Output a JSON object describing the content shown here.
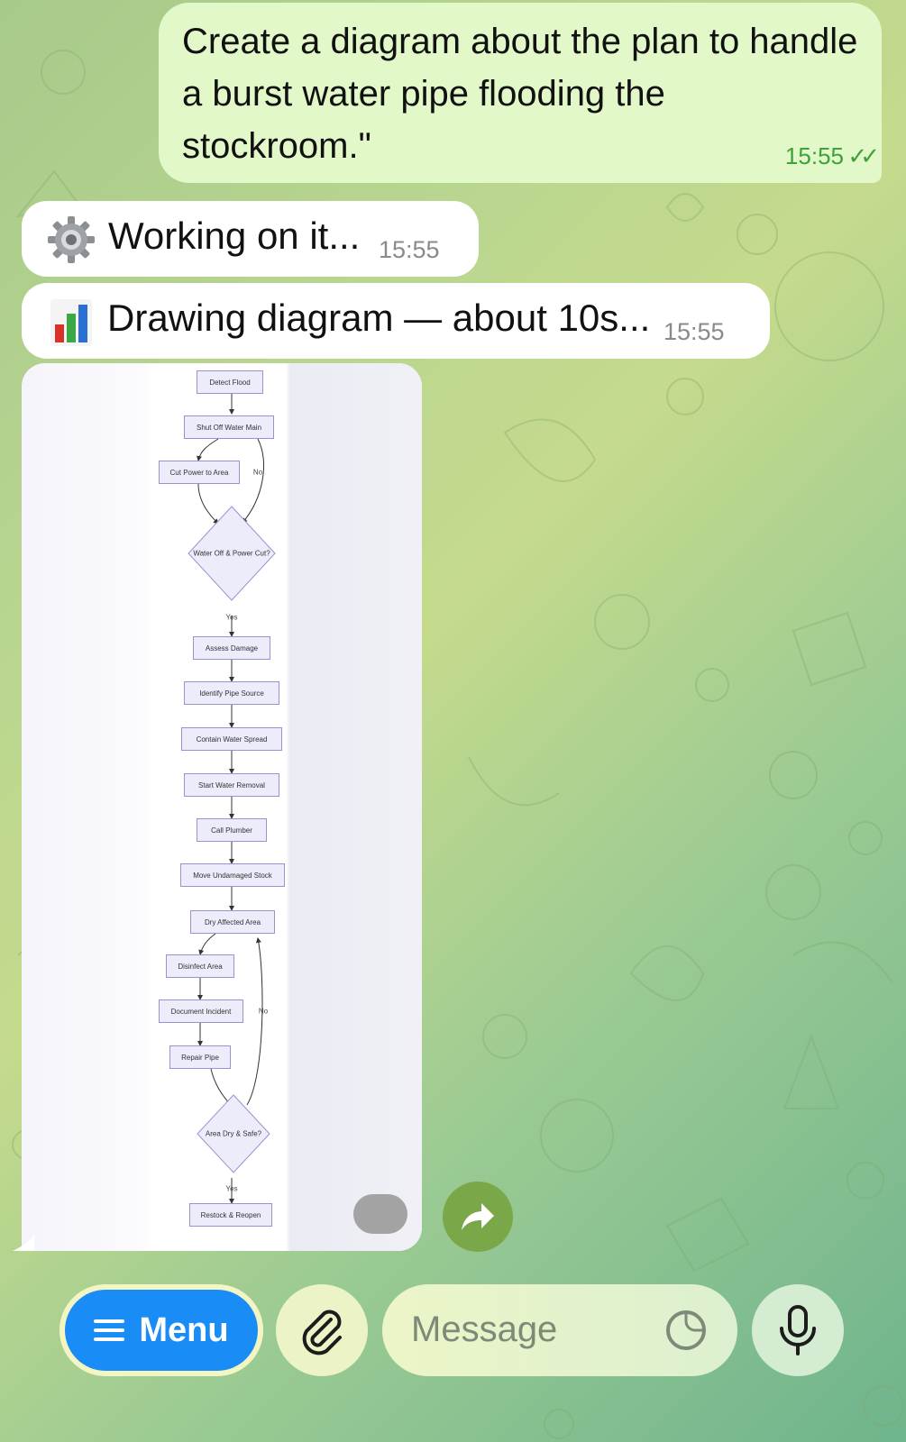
{
  "chat": {
    "outgoing": {
      "text": "Create a diagram about the plan to handle a burst water pipe flooding the stockroom.\"",
      "time": "15:55",
      "ticks": "✓✓"
    },
    "working": {
      "text": "Working on it...",
      "time": "15:55",
      "icon": "gear-icon"
    },
    "drawing": {
      "text": "Drawing diagram — about 10s...",
      "time": "15:55",
      "icon": "bar-chart-icon"
    }
  },
  "diagram": {
    "nodes": {
      "detect_flood": "Detect Flood",
      "shut_off": "Shut Off Water Main",
      "cut_power": "Cut Power to Area",
      "decision1": "Water Off & Power Cut?",
      "assess": "Assess Damage",
      "identify": "Identify Pipe Source",
      "contain": "Contain Water Spread",
      "start_removal": "Start Water Removal",
      "call_plumber": "Call Plumber",
      "move_stock": "Move Undamaged Stock",
      "dry_area": "Dry Affected Area",
      "disinfect": "Disinfect Area",
      "document": "Document Incident",
      "repair": "Repair Pipe",
      "decision2": "Area Dry & Safe?",
      "restock": "Restock & Reopen"
    },
    "edges": {
      "no1": "No",
      "yes1": "Yes",
      "no2": "No",
      "yes2": "Yes"
    }
  },
  "composer": {
    "menu_label": "Menu",
    "placeholder": "Message",
    "icons": [
      "menu-lines-icon",
      "paperclip-icon",
      "sticker-icon",
      "microphone-icon",
      "share-arrow-icon"
    ]
  },
  "colors": {
    "outgoing_bubble": "#e2f8c8",
    "menu_button": "#1a8cf5",
    "share_button": "#7aa848",
    "node_fill": "#ececfb",
    "node_border": "#9a92cf"
  }
}
